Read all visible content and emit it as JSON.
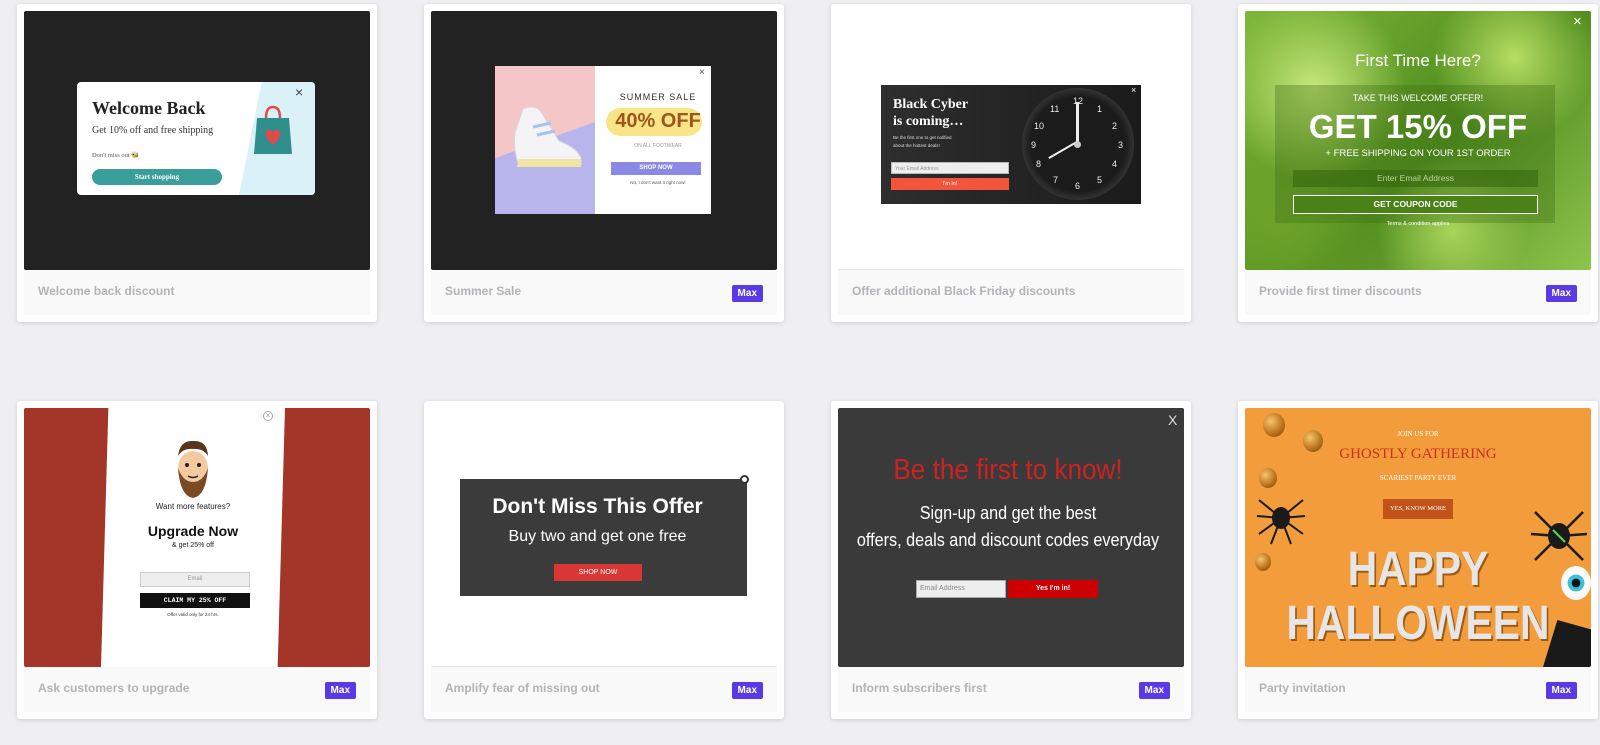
{
  "templates": [
    {
      "name": "Welcome back discount",
      "badge": "",
      "popup": {
        "heading": "Welcome Back",
        "subtitle": "Get 10% off and free shipping",
        "note": "Don't miss out 🐝",
        "button": "Start shopping",
        "close": "×"
      }
    },
    {
      "name": "Summer Sale",
      "badge": "Max",
      "popup": {
        "heading": "SUMMER SALE",
        "offer": "40% OFF",
        "subtitle": "ON ALL FOOTWEAR",
        "button": "SHOP NOW",
        "decline": "No, I don't want it right now!",
        "close": "×"
      }
    },
    {
      "name": "Offer additional Black Friday discounts",
      "badge": "",
      "popup": {
        "heading_line1": "Black Cyber",
        "heading_line2": "is coming…",
        "body_line1": "Be the first one to get notified",
        "body_line2": "about the hottest deals!",
        "email_placeholder": "Your Email Address",
        "button": "I'm in!",
        "close": "×",
        "clock_numbers": [
          "12",
          "1",
          "2",
          "3",
          "4",
          "5",
          "6",
          "7",
          "8",
          "9",
          "10",
          "11"
        ]
      }
    },
    {
      "name": "Provide first timer discounts",
      "badge": "Max",
      "popup": {
        "heading": "First Time Here?",
        "eyebrow": "TAKE THIS WELCOME OFFER!",
        "offer": "GET 15% OFF",
        "subtitle": "+ FREE SHIPPING ON YOUR 1ST ORDER",
        "email_placeholder": "Enter Email Address",
        "button": "GET COUPON CODE",
        "terms": "Terms & condition applies",
        "close": "×"
      }
    },
    {
      "name": "Ask customers to upgrade",
      "badge": "Max",
      "popup": {
        "prompt": "Want more features?",
        "heading": "Upgrade Now",
        "subtitle": "& get 25% off",
        "email_placeholder": "Email",
        "button": "CLAIM MY 25% OFF",
        "note": "Offer valid only for 24 hrs.",
        "close": "×"
      }
    },
    {
      "name": "Amplify fear of missing out",
      "badge": "Max",
      "popup": {
        "heading": "Don't Miss This Offer",
        "subtitle": "Buy two and get one free",
        "button": "SHOP NOW"
      }
    },
    {
      "name": "Inform subscribers first",
      "badge": "Max",
      "popup": {
        "heading": "Be the first to know!",
        "line1": "Sign-up and get the best",
        "line2": "offers, deals and discount codes everyday",
        "email_placeholder": "Email Address",
        "button": "Yes I'm in!",
        "close": "X"
      }
    },
    {
      "name": "Party invitation",
      "badge": "Max",
      "popup": {
        "eyebrow": "JOIN US FOR",
        "heading": "GHOSTLY GATHERING",
        "subtitle": "SCARIEST PARTY EVER",
        "button": "YES, KNOW MORE",
        "big_line1": "HAPPY",
        "big_line2": "HALLOWEEN"
      }
    }
  ],
  "colors": {
    "badge": "#5a39e6",
    "teal": "#3a9e9a",
    "orange_red": "#f4543c",
    "halloween_orange": "#f39c3c",
    "upgrade_red": "#a33628",
    "inform_red": "#cc2222"
  }
}
